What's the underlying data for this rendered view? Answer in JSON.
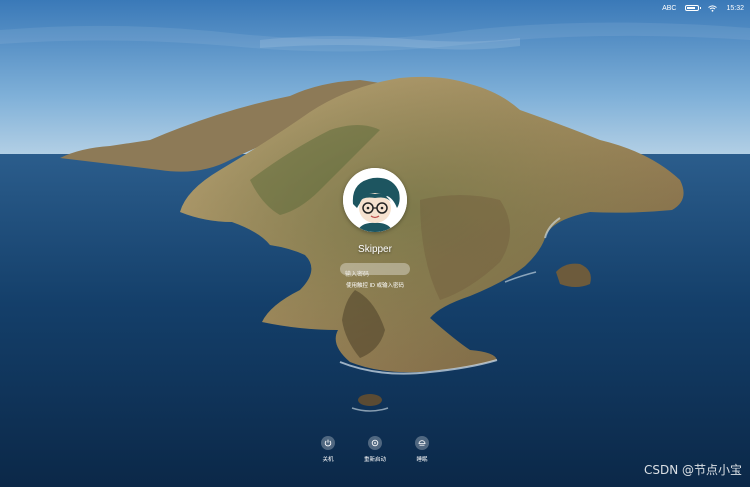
{
  "menubar": {
    "input_source": "ABC",
    "clock": "15:32"
  },
  "login": {
    "username": "Skipper",
    "password_placeholder": "输入密码",
    "hint": "使用触控 ID 或输入密码"
  },
  "actions": [
    {
      "label": "关机",
      "icon": "power-icon"
    },
    {
      "label": "重新启动",
      "icon": "restart-icon"
    },
    {
      "label": "睡眠",
      "icon": "sleep-icon"
    }
  ],
  "watermark": "CSDN @节点小宝",
  "colors": {
    "sky_top": "#3f7fbe",
    "sea": "#123a63",
    "island": "#a68f64",
    "avatar_hair": "#1d5560"
  }
}
